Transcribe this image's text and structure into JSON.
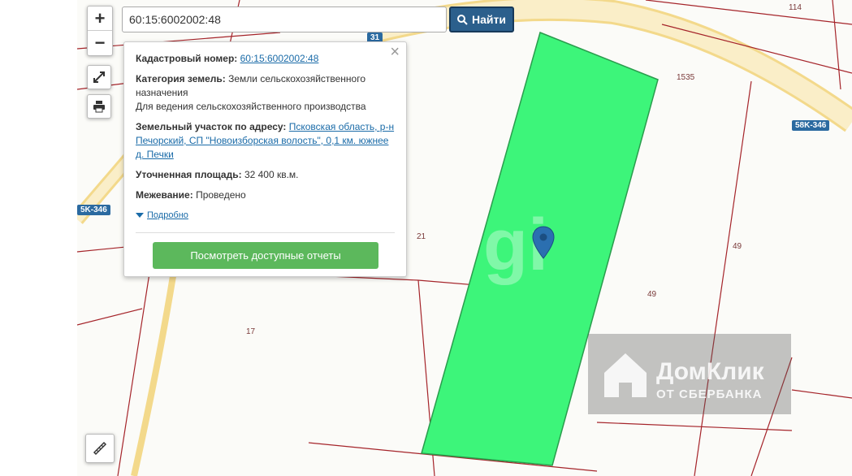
{
  "search": {
    "value": "60:15:6002002:48",
    "button_label": "Найти"
  },
  "zoom": {
    "in": "+",
    "out": "−"
  },
  "popup": {
    "cadastral_label": "Кадастровый номер:",
    "cadastral_value": "60:15:6002002:48",
    "category_label": "Категория земель:",
    "category_value": "Земли сельскохозяйственного назначения",
    "usage_value": "Для ведения сельскохозяйственного производства",
    "address_label": "Земельный участок по адресу:",
    "address_value": "Псковская область, р-н Печорский, СП \"Новоизборская волость\", 0,1 км. южнее д. Печки",
    "area_label": "Уточненная площадь:",
    "area_value": "32 400 кв.м.",
    "survey_label": "Межевание:",
    "survey_value": "Проведено",
    "more_label": "Подробно",
    "view_button": "Посмотреть доступные отчеты"
  },
  "map_labels": {
    "parcel_114": "114",
    "parcel_1535": "1535",
    "road_badge_right": "58K-346",
    "road_badge_left": "5K-346",
    "parcel_21": "21",
    "parcel_49a": "49",
    "parcel_49b": "49",
    "parcel_17": "17",
    "road_badge_top": "31"
  },
  "watermark": {
    "title": "ДомКлик",
    "subtitle": "ОТ СБЕРБАНКА"
  },
  "colors": {
    "parcel_fill": "#3df57a",
    "road": "#f7e3a8",
    "boundary": "#a5242a",
    "accent": "#2b5f8c"
  }
}
